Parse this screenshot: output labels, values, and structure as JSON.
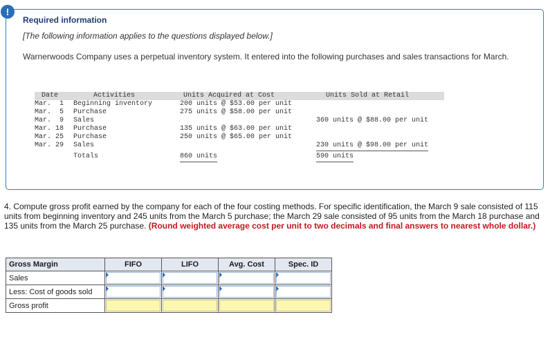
{
  "alert_glyph": "!",
  "info": {
    "title": "Required information",
    "subtitle": "[The following information applies to the questions displayed below.]",
    "description": "Warnerwoods Company uses a perpetual inventory system. It entered into the following purchases and sales transactions for March."
  },
  "ledger": {
    "headers": {
      "date": "Date",
      "activities": "Activities",
      "acquired": "Units Acquired at Cost",
      "sold": "Units Sold at Retail"
    },
    "rows": [
      {
        "date": "Mar.  1",
        "activity": "Beginning inventory",
        "acquired": "200 units @ $53.00 per unit",
        "sold": ""
      },
      {
        "date": "Mar.  5",
        "activity": "Purchase",
        "acquired": "275 units @ $58.00 per unit",
        "sold": ""
      },
      {
        "date": "Mar.  9",
        "activity": "Sales",
        "acquired": "",
        "sold": "360 units @ $88.00 per unit"
      },
      {
        "date": "Mar. 18",
        "activity": "Purchase",
        "acquired": "135 units @ $63.00 per unit",
        "sold": ""
      },
      {
        "date": "Mar. 25",
        "activity": "Purchase",
        "acquired": "250 units @ $65.00 per unit",
        "sold": ""
      },
      {
        "date": "Mar. 29",
        "activity": "Sales",
        "acquired": "",
        "sold": "230 units @ $98.00 per unit"
      }
    ],
    "totals_label": "Totals",
    "total_acquired": "860 units",
    "total_sold": "590 units"
  },
  "question": {
    "text": "4. Compute gross profit earned by the company for each of the four costing methods. For specific identification, the March 9 sale consisted of 115 units from beginning inventory and 245 units from the March 5 purchase; the March 29 sale consisted of 95 units from the March 18 purchase and 135 units from the March 25 purchase. ",
    "emphasis": "(Round weighted average cost per unit to two decimals and final answers to nearest whole dollar.)"
  },
  "table": {
    "headers": [
      "Gross Margin",
      "FIFO",
      "LIFO",
      "Avg. Cost",
      "Spec. ID"
    ],
    "rows": [
      {
        "label": "Sales",
        "values": [
          "",
          "",
          "",
          ""
        ]
      },
      {
        "label": "Less: Cost of goods sold",
        "values": [
          "",
          "",
          "",
          ""
        ]
      },
      {
        "label": "Gross profit",
        "values": [
          "",
          "",
          "",
          ""
        ]
      }
    ]
  },
  "colors": {
    "accent": "#2a6fb5",
    "emphasis": "#c0181f",
    "highlight": "#fdf7b0"
  }
}
